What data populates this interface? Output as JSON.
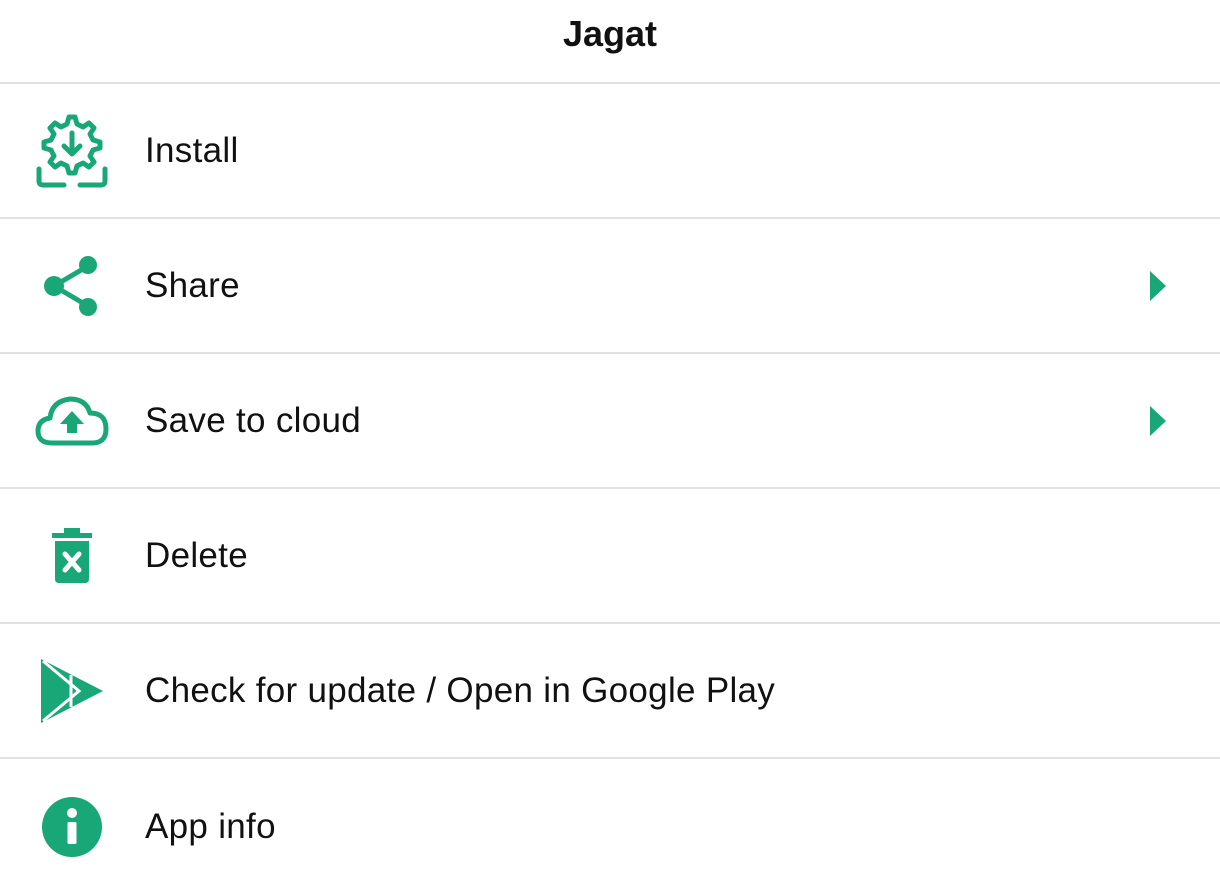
{
  "header": {
    "title": "Jagat"
  },
  "accent_color": "#1aa777",
  "menu": {
    "items": [
      {
        "label": "Install",
        "icon": "install-gear-icon",
        "has_submenu": false
      },
      {
        "label": "Share",
        "icon": "share-icon",
        "has_submenu": true
      },
      {
        "label": "Save to cloud",
        "icon": "cloud-upload-icon",
        "has_submenu": true
      },
      {
        "label": "Delete",
        "icon": "trash-icon",
        "has_submenu": false
      },
      {
        "label": "Check for update / Open in Google Play",
        "icon": "google-play-icon",
        "has_submenu": false
      },
      {
        "label": "App info",
        "icon": "info-icon",
        "has_submenu": false
      }
    ]
  }
}
